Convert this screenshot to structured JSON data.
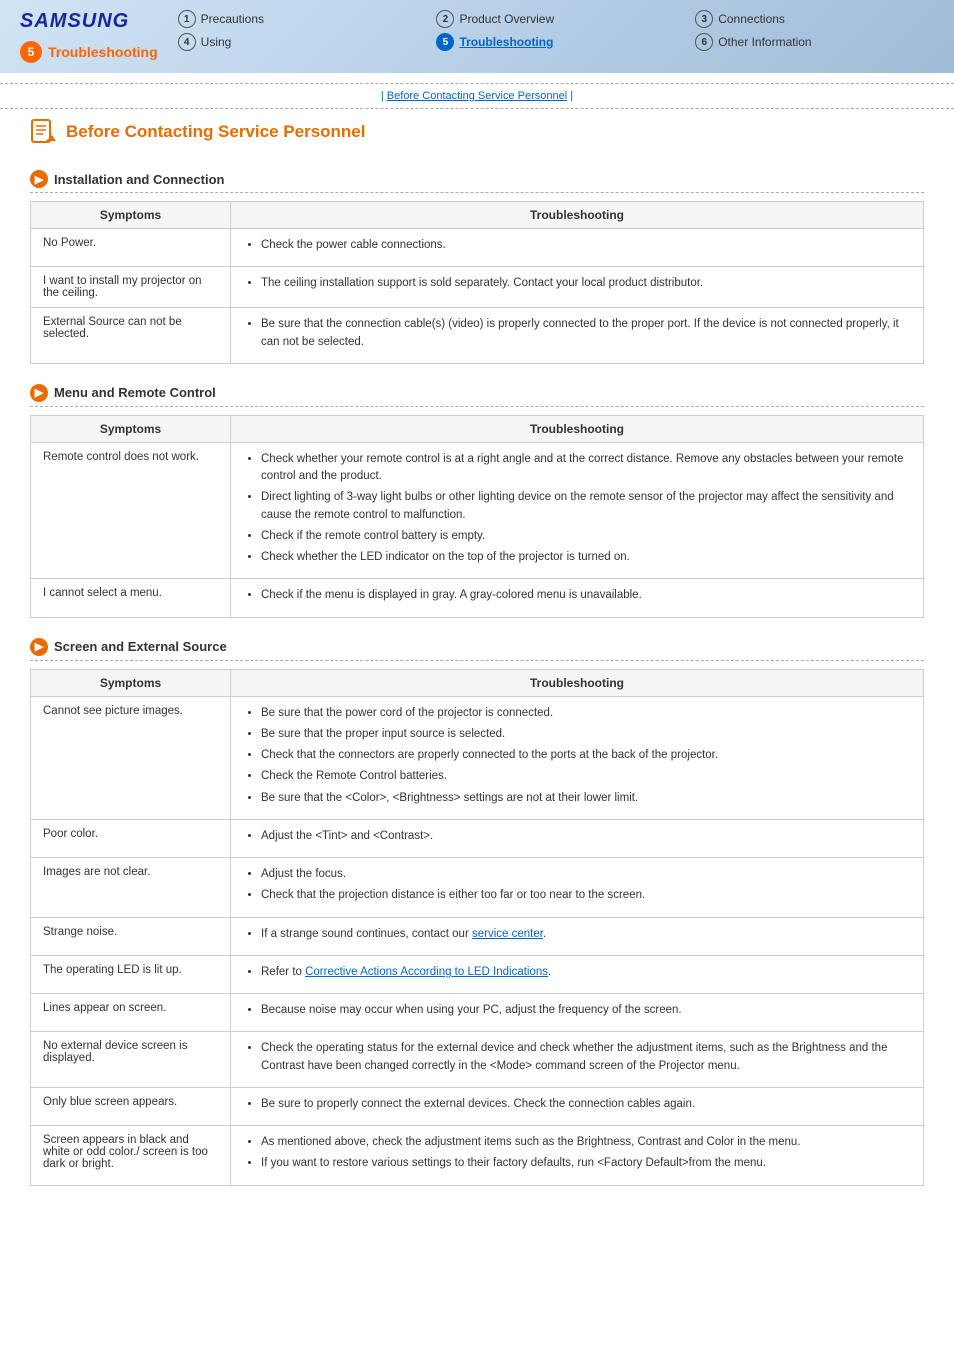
{
  "header": {
    "logo": "SAMSUNG",
    "nav_items": [
      {
        "num": "1",
        "label": "Precautions",
        "active": false,
        "highlight": false
      },
      {
        "num": "2",
        "label": "Product Overview",
        "active": false,
        "highlight": false
      },
      {
        "num": "3",
        "label": "Connections",
        "active": false,
        "highlight": false
      },
      {
        "num": "4",
        "label": "Using",
        "active": false,
        "highlight": false
      },
      {
        "num": "5",
        "label": "Troubleshooting",
        "active": true,
        "highlight": true
      },
      {
        "num": "6",
        "label": "Other Information",
        "active": false,
        "highlight": false
      }
    ],
    "current_section_num": "5",
    "current_section_label": "Troubleshooting"
  },
  "breadcrumb": {
    "link": "Before Contacting Service Personnel"
  },
  "page": {
    "title": "Before Contacting Service Personnel",
    "sections": [
      {
        "id": "installation",
        "title": "Installation and Connection",
        "columns": [
          "Symptoms",
          "Troubleshooting"
        ],
        "rows": [
          {
            "symptom": "No Power.",
            "troubleshooting": [
              "Check the power cable connections."
            ]
          },
          {
            "symptom": "I want to install my projector on the ceiling.",
            "troubleshooting": [
              "The ceiling installation support is sold separately. Contact your local product distributor."
            ]
          },
          {
            "symptom": "External Source can not be selected.",
            "troubleshooting": [
              "Be sure that the connection cable(s) (video) is properly connected to the proper port. If the device is not connected properly, it can not be selected."
            ]
          }
        ]
      },
      {
        "id": "menu",
        "title": "Menu and Remote Control",
        "columns": [
          "Symptoms",
          "Troubleshooting"
        ],
        "rows": [
          {
            "symptom": "Remote control does not work.",
            "troubleshooting": [
              "Check whether your remote control is at a right angle and at the correct distance. Remove any obstacles between your remote control and the product.",
              "Direct lighting of 3-way light bulbs or other lighting device on the remote sensor of the projector may affect the sensitivity and cause the remote control to malfunction.",
              "Check if the remote control battery is empty.",
              "Check whether the LED indicator on the top of the projector is turned on."
            ]
          },
          {
            "symptom": "I cannot select a menu.",
            "troubleshooting": [
              "Check if the menu is displayed in gray. A gray-colored menu is unavailable."
            ]
          }
        ]
      },
      {
        "id": "screen",
        "title": "Screen and External Source",
        "columns": [
          "Symptoms",
          "Troubleshooting"
        ],
        "rows": [
          {
            "symptom": "Cannot see picture images.",
            "troubleshooting": [
              "Be sure that the power cord of the projector is connected.",
              "Be sure that the proper input source is selected.",
              "Check that the connectors are properly connected to the ports at the back of the projector.",
              "Check the Remote Control batteries.",
              "Be sure that the <Color>, <Brightness> settings are not at their lower limit."
            ]
          },
          {
            "symptom": "Poor color.",
            "troubleshooting": [
              "Adjust the <Tint> and <Contrast>."
            ]
          },
          {
            "symptom": "Images are not clear.",
            "troubleshooting": [
              "Adjust the focus.",
              "Check that the projection distance is either too far or too near to the screen."
            ]
          },
          {
            "symptom": "Strange noise.",
            "troubleshooting": [
              "If a strange sound continues, contact our service center."
            ],
            "links": {
              "service center": "service-center"
            }
          },
          {
            "symptom": "The operating LED is lit up.",
            "troubleshooting": [
              "Refer to Corrective Actions According to LED Indications."
            ],
            "links": {
              "Corrective Actions According to LED Indications": "led-indications"
            }
          },
          {
            "symptom": "Lines appear on screen.",
            "troubleshooting": [
              "Because noise may occur when using your PC, adjust the frequency of the screen."
            ]
          },
          {
            "symptom": "No external device screen is displayed.",
            "troubleshooting": [
              "Check the operating status for the external device and check whether the adjustment items, such as the Brightness and the Contrast have been changed correctly in the <Mode> command screen of the Projector menu."
            ]
          },
          {
            "symptom": "Only blue screen appears.",
            "troubleshooting": [
              "Be sure to properly connect the external devices. Check the connection cables again."
            ]
          },
          {
            "symptom": "Screen appears in black and white or odd color./ screen is too dark or bright.",
            "troubleshooting": [
              "As mentioned above, check the adjustment items such as the Brightness, Contrast and Color in the menu.",
              "If you want to restore various settings to their factory defaults, run <Factory Default>from the menu."
            ]
          }
        ]
      }
    ]
  }
}
